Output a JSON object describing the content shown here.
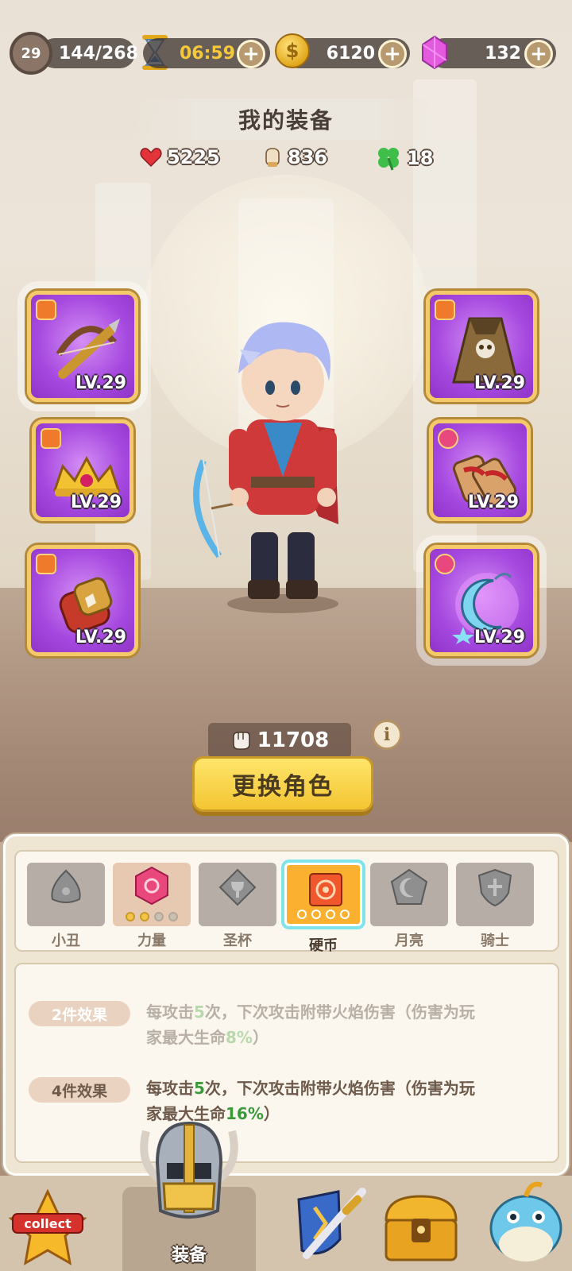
{
  "top_bar": {
    "player_level": "29",
    "xp": "144/268",
    "timer": "06:59",
    "coins": "6120",
    "gems": "132",
    "plus_label": "+"
  },
  "header": {
    "title": "我的装备",
    "hp": "5225",
    "attack": "836",
    "luck": "18"
  },
  "equipment": {
    "left": [
      {
        "icon": "crossbow-icon",
        "level": "LV.29"
      },
      {
        "icon": "crown-icon",
        "level": "LV.29"
      },
      {
        "icon": "gauntlet-icon",
        "level": "LV.29"
      }
    ],
    "right": [
      {
        "icon": "cloak-icon",
        "level": "LV.29"
      },
      {
        "icon": "sandals-icon",
        "level": "LV.29"
      },
      {
        "icon": "moon-charm-icon",
        "level": "LV.29"
      }
    ]
  },
  "hero": {
    "power": "11708",
    "info_label": "i",
    "change_button": "更换角色"
  },
  "set_tabs": [
    {
      "label": "小丑",
      "icon": "clown-set-icon"
    },
    {
      "label": "力量",
      "icon": "strength-set-icon"
    },
    {
      "label": "圣杯",
      "icon": "grail-set-icon"
    },
    {
      "label": "硬币",
      "icon": "coin-set-icon"
    },
    {
      "label": "月亮",
      "icon": "moon-set-icon"
    },
    {
      "label": "骑士",
      "icon": "knight-set-icon"
    }
  ],
  "set_effects": [
    {
      "tag": "2件效果",
      "line1_a": "每攻击",
      "line1_num": "5",
      "line1_b": "次，下次攻击附带火焰伤害（伤害为玩",
      "line2_a": "家最大生命",
      "line2_num": "8%",
      "line2_b": "）"
    },
    {
      "tag": "4件效果",
      "line1_a": "每攻击",
      "line1_num": "5",
      "line1_b": "次，下次攻击附带火焰伤害（伤害为玩",
      "line2_a": "家最大生命",
      "line2_num": "16%",
      "line2_b": "）"
    }
  ],
  "nav": {
    "collect_badge": "collect",
    "equipment_label": "装备"
  },
  "colors": {
    "slot_purple": "#a548df",
    "slot_border": "#f3c96a",
    "button_yellow": "#f3c532",
    "active_tab": "#fbb030",
    "effect_green": "#3a9a3a"
  }
}
